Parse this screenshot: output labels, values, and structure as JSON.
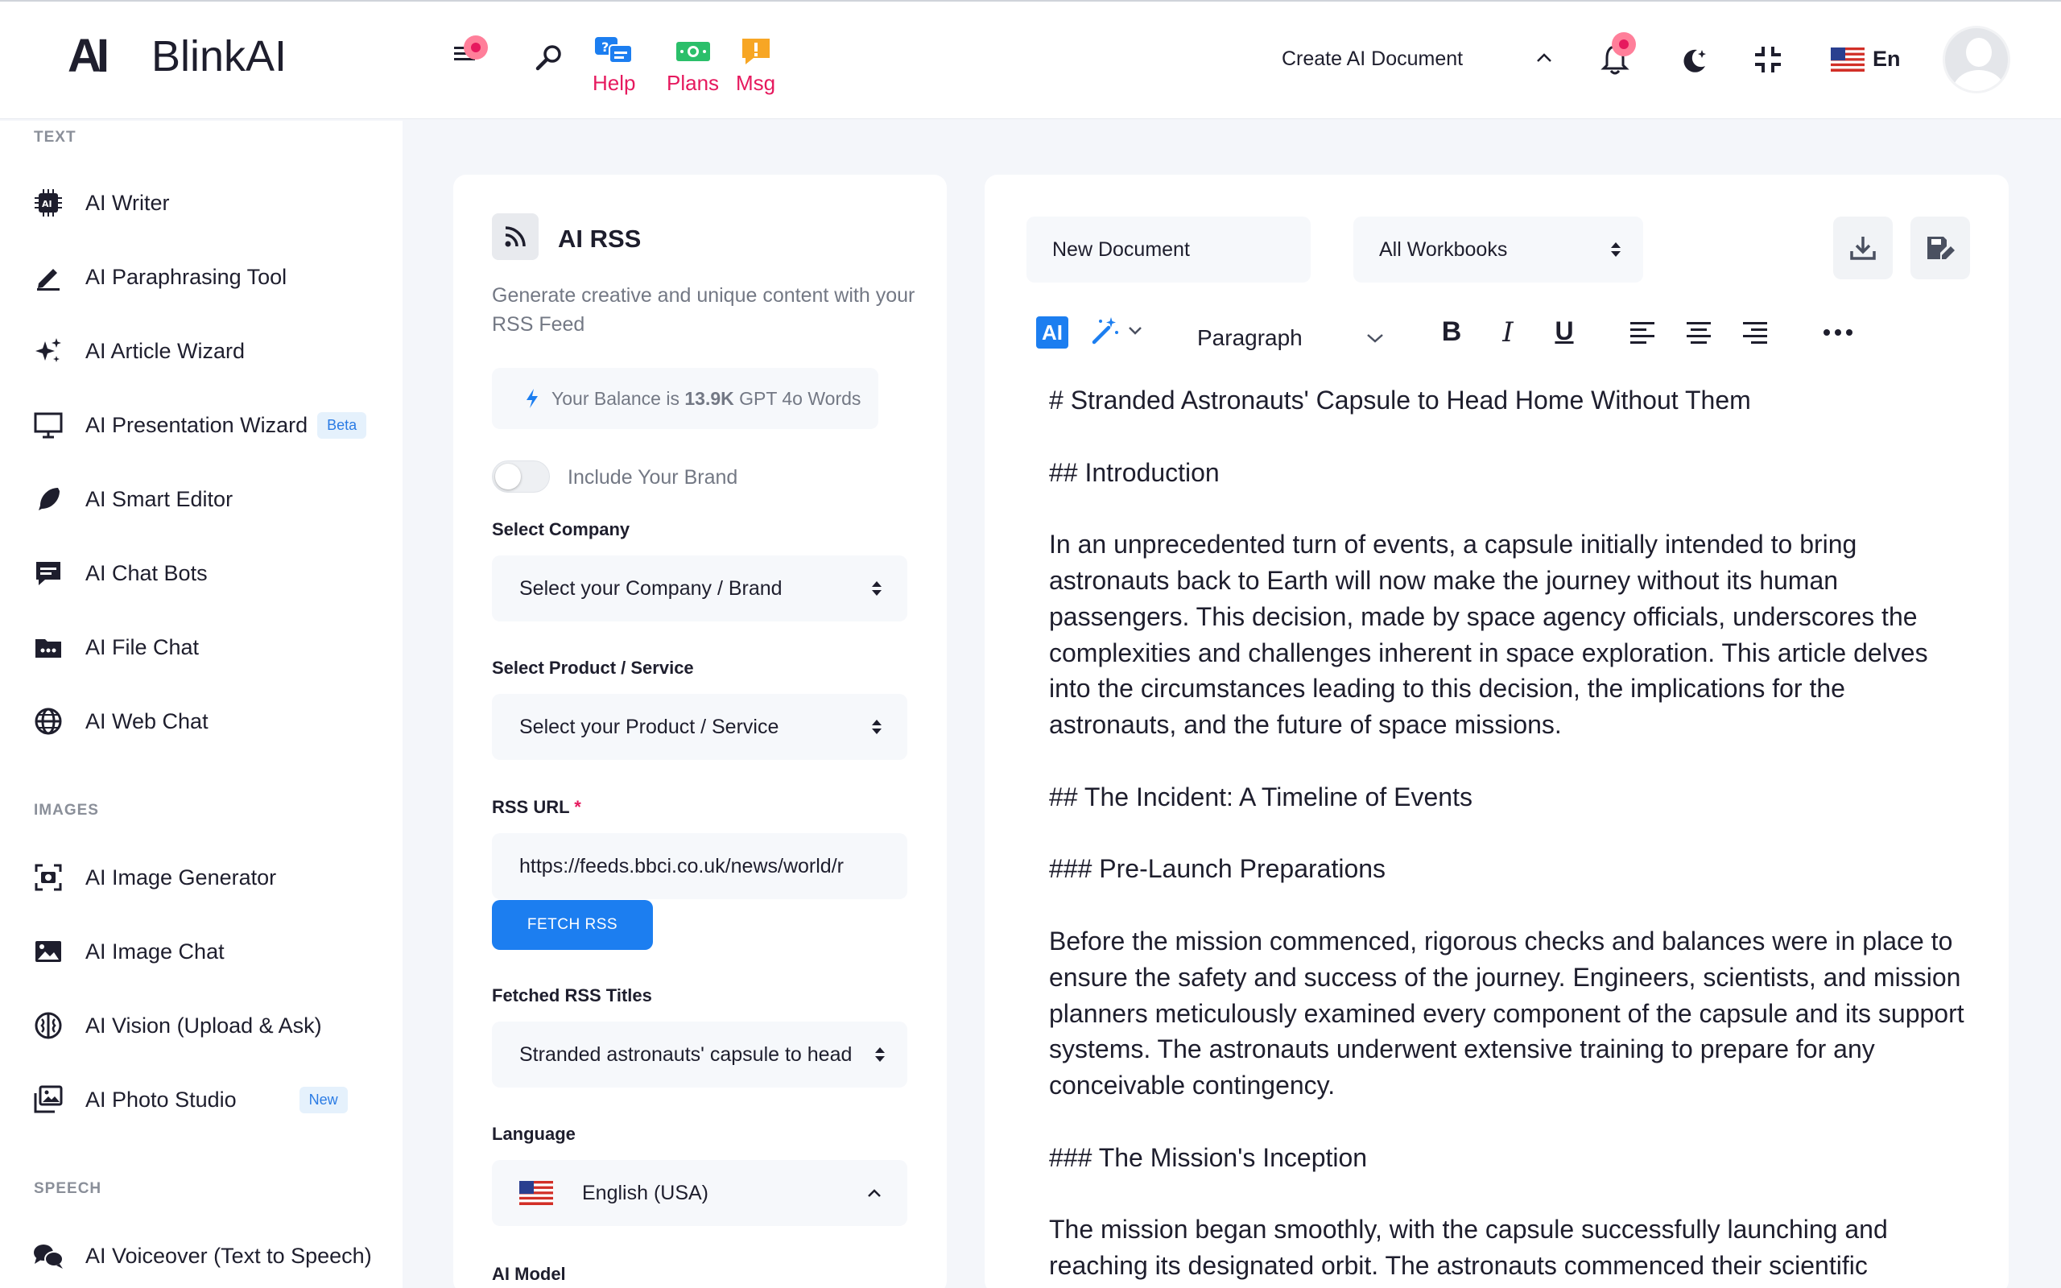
{
  "header": {
    "logo_mark": "AI",
    "logo_text": "BlinkAI",
    "help_label": "Help",
    "plans_label": "Plans",
    "msg_label": "Msg",
    "create_doc_label": "Create AI Document",
    "language": "En",
    "accent_color": "#e6195e"
  },
  "sidebar": {
    "sections": {
      "text": "TEXT",
      "images": "IMAGES",
      "speech": "SPEECH"
    },
    "items": [
      {
        "label": "AI Writer",
        "icon": "chip-icon"
      },
      {
        "label": "AI Paraphrasing Tool",
        "icon": "pen-icon"
      },
      {
        "label": "AI Article Wizard",
        "icon": "sparkle-icon"
      },
      {
        "label": "AI Presentation Wizard",
        "icon": "presentation-icon",
        "badge": "Beta"
      },
      {
        "label": "AI Smart Editor",
        "icon": "feather-icon"
      },
      {
        "label": "AI Chat Bots",
        "icon": "chat-icon"
      },
      {
        "label": "AI File Chat",
        "icon": "folder-icon"
      },
      {
        "label": "AI Web Chat",
        "icon": "globe-icon"
      },
      {
        "label": "AI Image Generator",
        "icon": "image-scan-icon"
      },
      {
        "label": "AI Image Chat",
        "icon": "image-icon"
      },
      {
        "label": "AI Vision (Upload & Ask)",
        "icon": "brain-icon"
      },
      {
        "label": "AI Photo Studio",
        "icon": "photos-icon",
        "badge": "New"
      },
      {
        "label": "AI Voiceover (Text to Speech)",
        "icon": "voice-chat-icon"
      }
    ]
  },
  "panel": {
    "title": "AI RSS",
    "description": "Generate creative and unique content with your RSS Feed",
    "balance_prefix": "Your Balance is ",
    "balance_value": "13.9K",
    "balance_suffix": " GPT 4o Words",
    "include_brand_label": "Include Your Brand",
    "select_company_label": "Select Company",
    "select_company_value": "Select your Company / Brand",
    "select_product_label": "Select Product / Service",
    "select_product_value": "Select your Product / Service",
    "rss_url_label": "RSS URL",
    "rss_url_required": "*",
    "rss_url_value": "https://feeds.bbci.co.uk/news/world/r",
    "fetch_button": "FETCH RSS",
    "fetched_titles_label": "Fetched RSS Titles",
    "fetched_titles_value": "Stranded astronauts' capsule to head",
    "language_label": "Language",
    "language_value": "English (USA)",
    "ai_model_label": "AI Model"
  },
  "editor": {
    "document_name": "New Document",
    "workbook": "All Workbooks",
    "ai_badge": "AI",
    "paragraph_select": "Paragraph",
    "content": [
      "# Stranded Astronauts' Capsule to Head Home Without Them",
      "## Introduction",
      "In an unprecedented turn of events, a capsule initially intended to bring astronauts back to Earth will now make the journey without its human passengers. This decision, made by space agency officials, underscores the complexities and challenges inherent in space exploration. This article delves into the circumstances leading to this decision, the implications for the astronauts, and the future of space missions.",
      "## The Incident: A Timeline of Events",
      "### Pre-Launch Preparations",
      "Before the mission commenced, rigorous checks and balances were in place to ensure the safety and success of the journey. Engineers, scientists, and mission planners meticulously examined every component of the capsule and its support systems. The astronauts underwent extensive training to prepare for any conceivable contingency.",
      "### The Mission's Inception",
      "The mission began smoothly, with the capsule successfully launching and reaching its designated orbit. The astronauts commenced their scientific"
    ]
  }
}
